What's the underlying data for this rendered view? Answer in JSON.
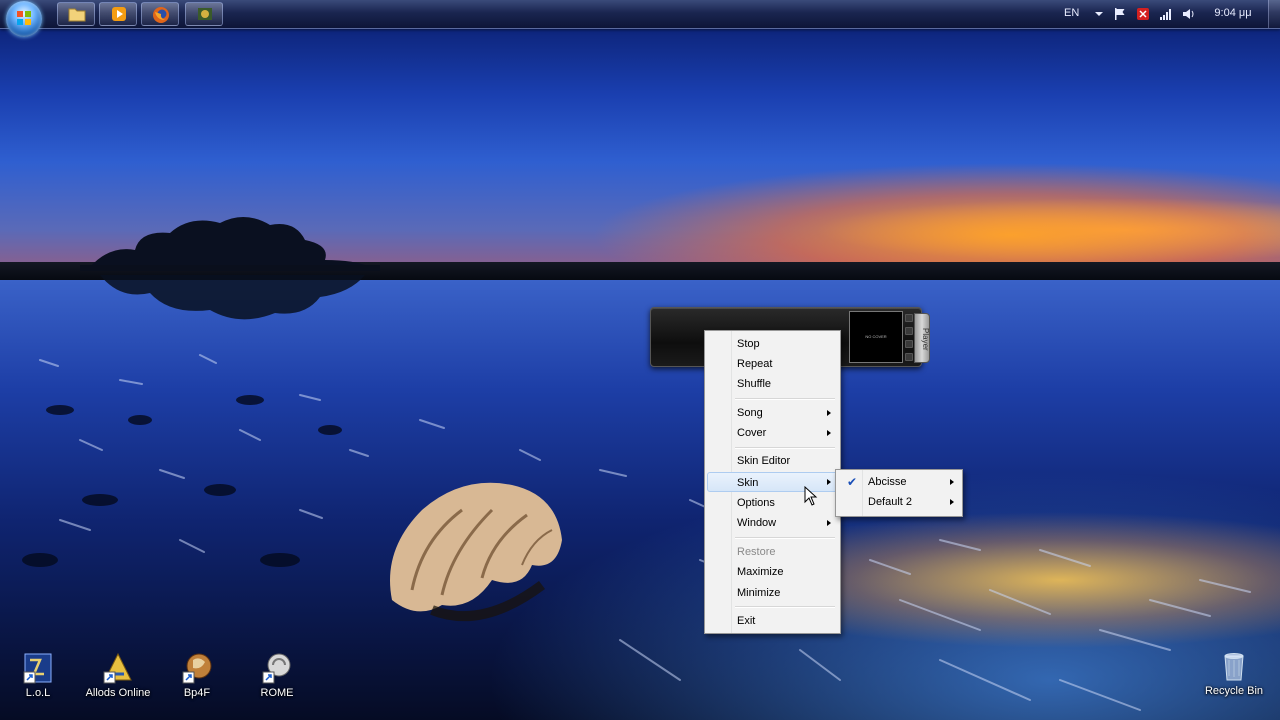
{
  "taskbar": {
    "start_icon": "windows-logo-icon",
    "pinned": [
      {
        "name": "explorer",
        "icon": "folder-icon"
      },
      {
        "name": "media-player",
        "icon": "media-player-icon"
      },
      {
        "name": "firefox",
        "icon": "firefox-icon"
      },
      {
        "name": "game",
        "icon": "game-icon"
      }
    ],
    "tray": {
      "language": "EN",
      "clock": "9:04 μμ",
      "icons": [
        "chevron-down-icon",
        "action-center-flag-icon",
        "red-app-icon",
        "network-signal-icon",
        "volume-icon"
      ]
    }
  },
  "desktop": {
    "icons": [
      {
        "label": "L.o.L",
        "icon": "lol-game-icon"
      },
      {
        "label": "Allods Online",
        "icon": "allods-game-icon"
      },
      {
        "label": "Bp4F",
        "icon": "bp4f-game-icon"
      },
      {
        "label": "ROME",
        "icon": "rome-game-icon"
      },
      {
        "label": "Recycle Bin",
        "icon": "recycle-bin-icon"
      }
    ]
  },
  "player": {
    "tab_label": "Player",
    "cover_text": "NO COVER"
  },
  "context_menu": {
    "items": {
      "stop": "Stop",
      "repeat": "Repeat",
      "shuffle": "Shuffle",
      "song": "Song",
      "cover": "Cover",
      "skin_editor": "Skin Editor",
      "skin": "Skin",
      "options": "Options",
      "window": "Window",
      "restore": "Restore",
      "maximize": "Maximize",
      "minimize": "Minimize",
      "exit": "Exit"
    },
    "highlighted": "Skin",
    "disabled": [
      "Restore"
    ]
  },
  "skin_submenu": {
    "items": [
      "Abcisse",
      "Default 2"
    ],
    "checked": "Abcisse"
  },
  "colors": {
    "menu_bg": "#f2f2f2",
    "menu_hover": "#d6e6f8",
    "taskbar": "#1a2550",
    "check": "#1a4fb8"
  }
}
